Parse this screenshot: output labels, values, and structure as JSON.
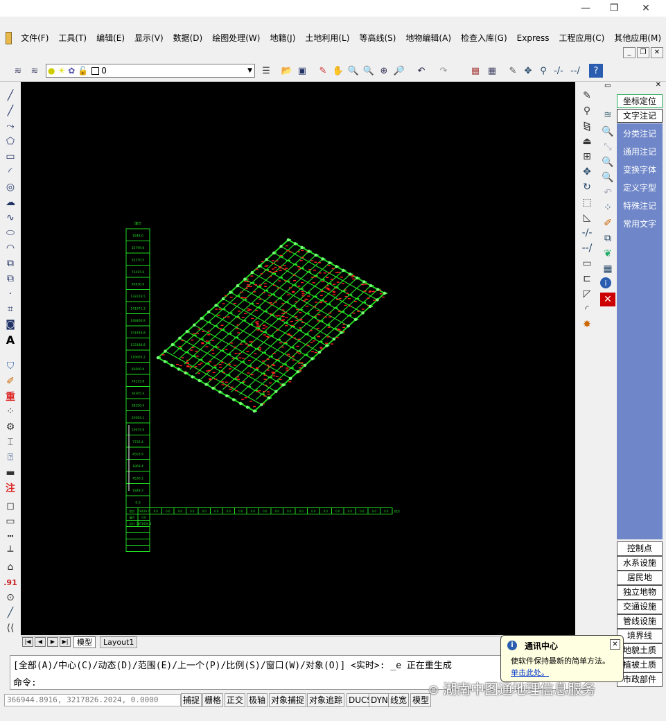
{
  "window": {
    "minimize": "—",
    "restore": "❐",
    "close": "✕"
  },
  "menu": [
    "文件(F)",
    "工具(T)",
    "编辑(E)",
    "显示(V)",
    "数据(D)",
    "绘图处理(W)",
    "地籍(J)",
    "土地利用(L)",
    "等高线(S)",
    "地物编辑(A)",
    "检查入库(G)",
    "Express",
    "工程应用(C)",
    "其他应用(M)"
  ],
  "layer": {
    "name": "0"
  },
  "right_panel": {
    "coord_btn": "坐标定位",
    "text_btn": "文字注记",
    "items": [
      "分类注记",
      "通用注记",
      "变换字体",
      "定义字型",
      "特殊注记",
      "常用文字"
    ],
    "categories": [
      "控制点",
      "水系设施",
      "居民地",
      "独立地物",
      "交通设施",
      "管线设施",
      "境界线",
      "地貌土质",
      "植被土质",
      "市政部件"
    ]
  },
  "tabs": {
    "model": "模型",
    "layout": "Layout1"
  },
  "command": {
    "line1": "[全部(A)/中心(C)/动态(D)/范围(E)/上一个(P)/比例(S)/窗口(W)/对象(O)] <实时>: _e 正在重生成",
    "line2": "命令:"
  },
  "status": {
    "coords": "366944.8916, 3217826.2024, 0.0000",
    "buttons": [
      "捕捉",
      "栅格",
      "正交",
      "极轴",
      "对象捕捉",
      "对象追踪",
      "DUCS",
      "DYN",
      "线宽",
      "模型"
    ]
  },
  "notification": {
    "title": "通讯中心",
    "body": "使软件保持最新的简单方法。",
    "link": "单击此处。"
  },
  "watermark": "湖南中图通地理信息服务",
  "drawing": {
    "col_header": "填方",
    "col_values": [
      "1848.0",
      "35799.6",
      "53370.5",
      "72415.6",
      "93830.6",
      "132216.5",
      "141971.3",
      "148800.9",
      "151446.8",
      "133188.8",
      "116605.2",
      "82600.9",
      "74115.8",
      "56305.4",
      "38350.4",
      "22064.1",
      "13975.9",
      "7735.4",
      "4503.9",
      "1869.4",
      "4530.1",
      "1848.3",
      "0.0"
    ],
    "row_labels": [
      "挖方",
      "填方",
      "总计"
    ],
    "row_values": [
      "79429.7",
      "0.0",
      "1871604.4"
    ],
    "axis_label": "挖方",
    "strip_values": [
      "0.0",
      "0.0",
      "0.0",
      "0.0",
      "0.0",
      "0.0",
      "0.0",
      "0.0",
      "0.0",
      "0.0",
      "0.0",
      "0.0",
      "0.0",
      "0.0",
      "0.0",
      "0.0",
      "0.0",
      "0.0",
      "0.0",
      "0.0"
    ],
    "grid_color": "#22dd22",
    "point_color": "#ff2222"
  }
}
